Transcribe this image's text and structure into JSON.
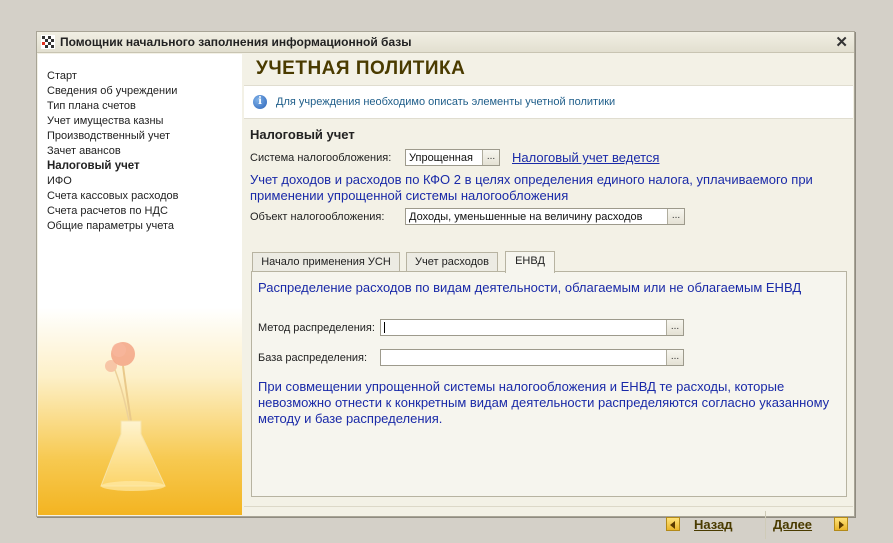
{
  "window": {
    "title": "Помощник начального заполнения информационной базы",
    "close_glyph": "✕"
  },
  "sidebar": {
    "items": [
      {
        "label": "Старт"
      },
      {
        "label": "Сведения об учреждении"
      },
      {
        "label": "Тип плана счетов"
      },
      {
        "label": "Учет имущества казны"
      },
      {
        "label": "Производственный учет"
      },
      {
        "label": "Зачет авансов"
      },
      {
        "label": "Налоговый учет",
        "active": true
      },
      {
        "label": "ИФО"
      },
      {
        "label": "Счета кассовых расходов"
      },
      {
        "label": "Счета расчетов по НДС"
      },
      {
        "label": "Общие параметры учета"
      }
    ]
  },
  "main": {
    "title": "УЧЕТНАЯ ПОЛИТИКА",
    "info_icon": "info-icon",
    "info_text": "Для учреждения необходимо описать элементы учетной политики",
    "section_title": "Налоговый учет",
    "tax_system": {
      "label": "Система налогообложения:",
      "value": "Упрощенная",
      "select_glyph": "..."
    },
    "tax_link": "Налоговый учет ведется",
    "kfo_note": "Учет доходов и расходов по КФО 2 в целях определения единого налога, уплачиваемого при применении упрощенной системы налогообложения",
    "tax_object": {
      "label": "Объект налогообложения:",
      "value": "Доходы, уменьшенные на величину расходов",
      "select_glyph": "..."
    },
    "tabs": [
      {
        "label": "Начало применения УСН"
      },
      {
        "label": "Учет расходов"
      },
      {
        "label": "ЕНВД",
        "active": true
      }
    ],
    "envd": {
      "heading": "Распределение расходов по видам деятельности, облагаемым или не облагаемым ЕНВД",
      "method": {
        "label": "Метод распределения:",
        "value": "",
        "select_glyph": "..."
      },
      "base": {
        "label": "База распределения:",
        "value": "",
        "select_glyph": "..."
      },
      "note": "При совмещении упрощенной системы налогообложения и ЕНВД те расходы, которые невозможно отнести к конкретным видам деятельности распределяются согласно указанному методу и базе распределения."
    }
  },
  "footer": {
    "back_label": "Назад",
    "next_label": "Далее"
  }
}
